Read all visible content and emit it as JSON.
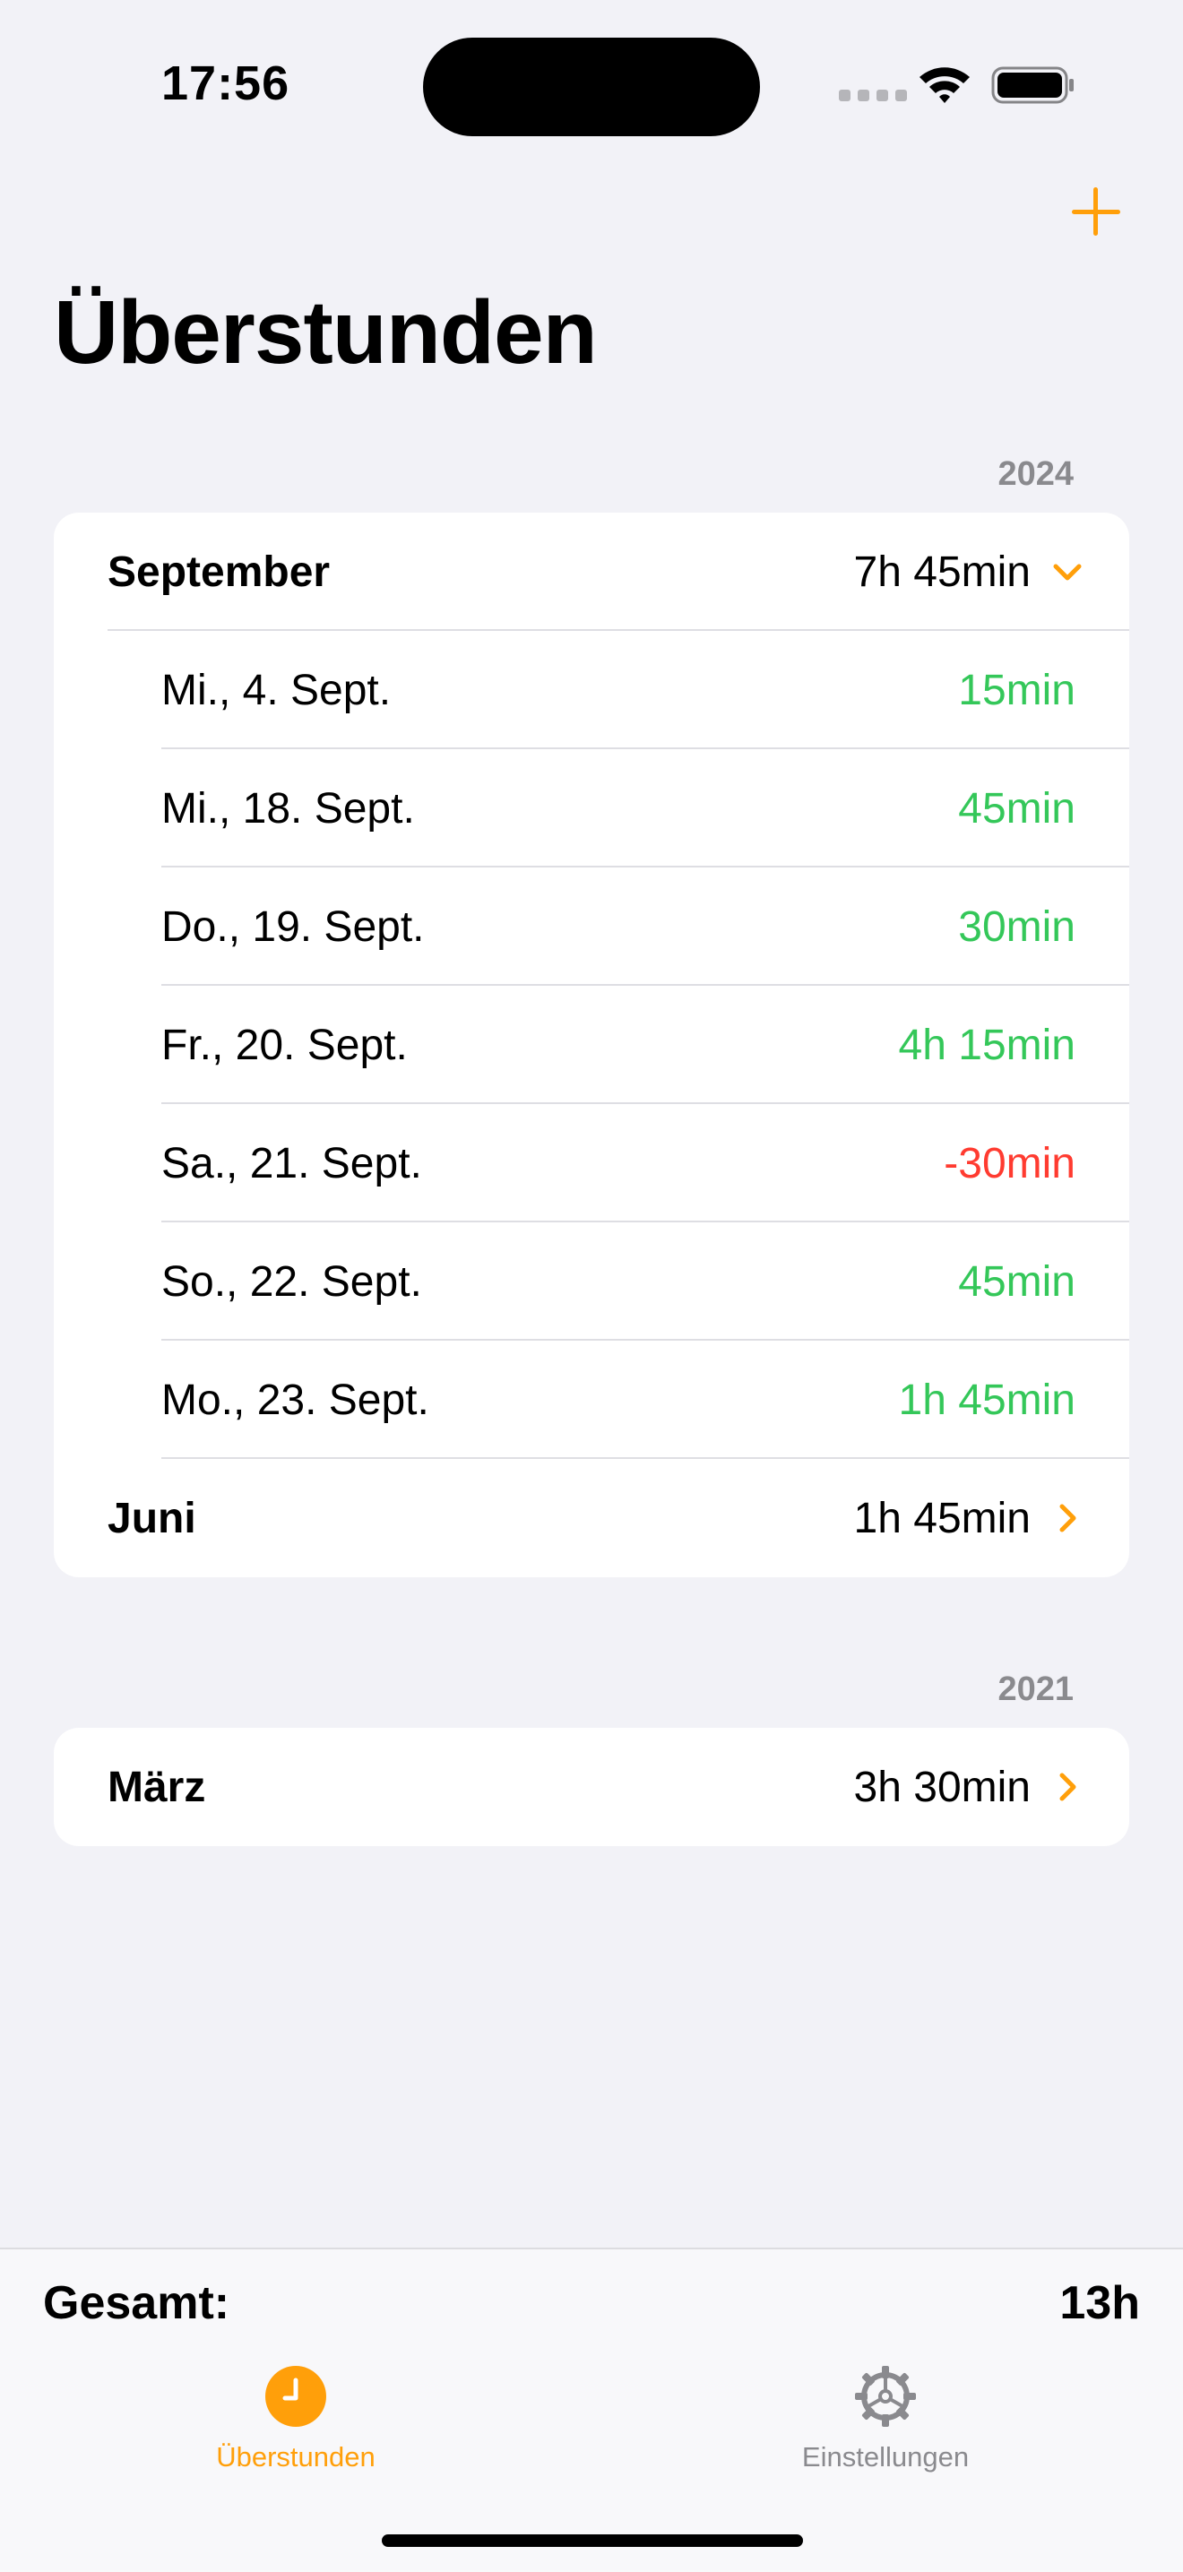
{
  "status_bar": {
    "time": "17:56"
  },
  "nav": {
    "title": "Überstunden",
    "add_icon": "plus-icon"
  },
  "colors": {
    "accent": "#ff9f0a",
    "positive": "#34c759",
    "negative": "#ff3b30",
    "background": "#f2f2f7"
  },
  "sections": [
    {
      "year": "2024",
      "months": [
        {
          "name": "September",
          "total": "7h 45min",
          "expanded": true,
          "chevron": "chevron-down-icon",
          "days": [
            {
              "date": "Mi., 4. Sept.",
              "value": "15min",
              "sign": "pos"
            },
            {
              "date": "Mi., 18. Sept.",
              "value": "45min",
              "sign": "pos"
            },
            {
              "date": "Do., 19. Sept.",
              "value": "30min",
              "sign": "pos"
            },
            {
              "date": "Fr., 20. Sept.",
              "value": "4h 15min",
              "sign": "pos"
            },
            {
              "date": "Sa., 21. Sept.",
              "value": "-30min",
              "sign": "neg"
            },
            {
              "date": "So., 22. Sept.",
              "value": "45min",
              "sign": "pos"
            },
            {
              "date": "Mo., 23. Sept.",
              "value": "1h 45min",
              "sign": "pos"
            }
          ]
        },
        {
          "name": "Juni",
          "total": "1h 45min",
          "expanded": false,
          "chevron": "chevron-right-icon"
        }
      ]
    },
    {
      "year": "2021",
      "months": [
        {
          "name": "März",
          "total": "3h 30min",
          "expanded": false,
          "chevron": "chevron-right-icon"
        }
      ]
    }
  ],
  "summary": {
    "label": "Gesamt:",
    "value": "13h"
  },
  "tabs": [
    {
      "label": "Überstunden",
      "icon": "clock-icon",
      "active": true
    },
    {
      "label": "Einstellungen",
      "icon": "gear-icon",
      "active": false
    }
  ]
}
